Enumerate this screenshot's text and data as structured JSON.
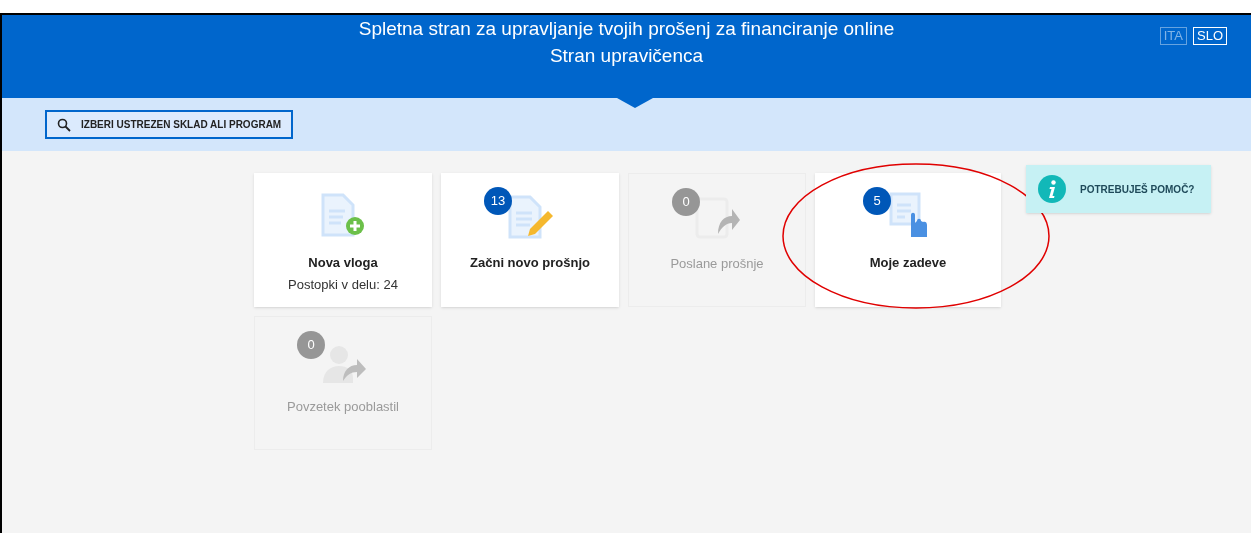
{
  "header": {
    "title": "Spletna stran za upravljanje tvojih prošenj za financiranje online",
    "subtitle": "Stran upravičenca",
    "languages": [
      {
        "label": "ITA",
        "selected": false
      },
      {
        "label": "SLO",
        "selected": true
      }
    ]
  },
  "search_button": {
    "label": "IZBERI USTREZEN SKLAD ALI PROGRAM"
  },
  "tiles": [
    {
      "kind": "new",
      "title": "Nova vloga",
      "subtitle": "Postopki v delu: 24",
      "disabled": false,
      "circled": false
    },
    {
      "kind": "edit",
      "badge": "13",
      "title": "Začni novo prošnjo",
      "disabled": false,
      "circled": false
    },
    {
      "kind": "sent",
      "badge": "0",
      "title": "Poslane prošnje",
      "disabled": true,
      "circled": false
    },
    {
      "kind": "cases",
      "badge": "5",
      "title": "Moje zadeve",
      "disabled": false,
      "circled": true
    },
    {
      "kind": "proxy",
      "badge": "0",
      "title": "Povzetek pooblastil",
      "disabled": true,
      "circled": false
    }
  ],
  "help": {
    "label": "POTREBUJEŠ POMOČ?"
  }
}
